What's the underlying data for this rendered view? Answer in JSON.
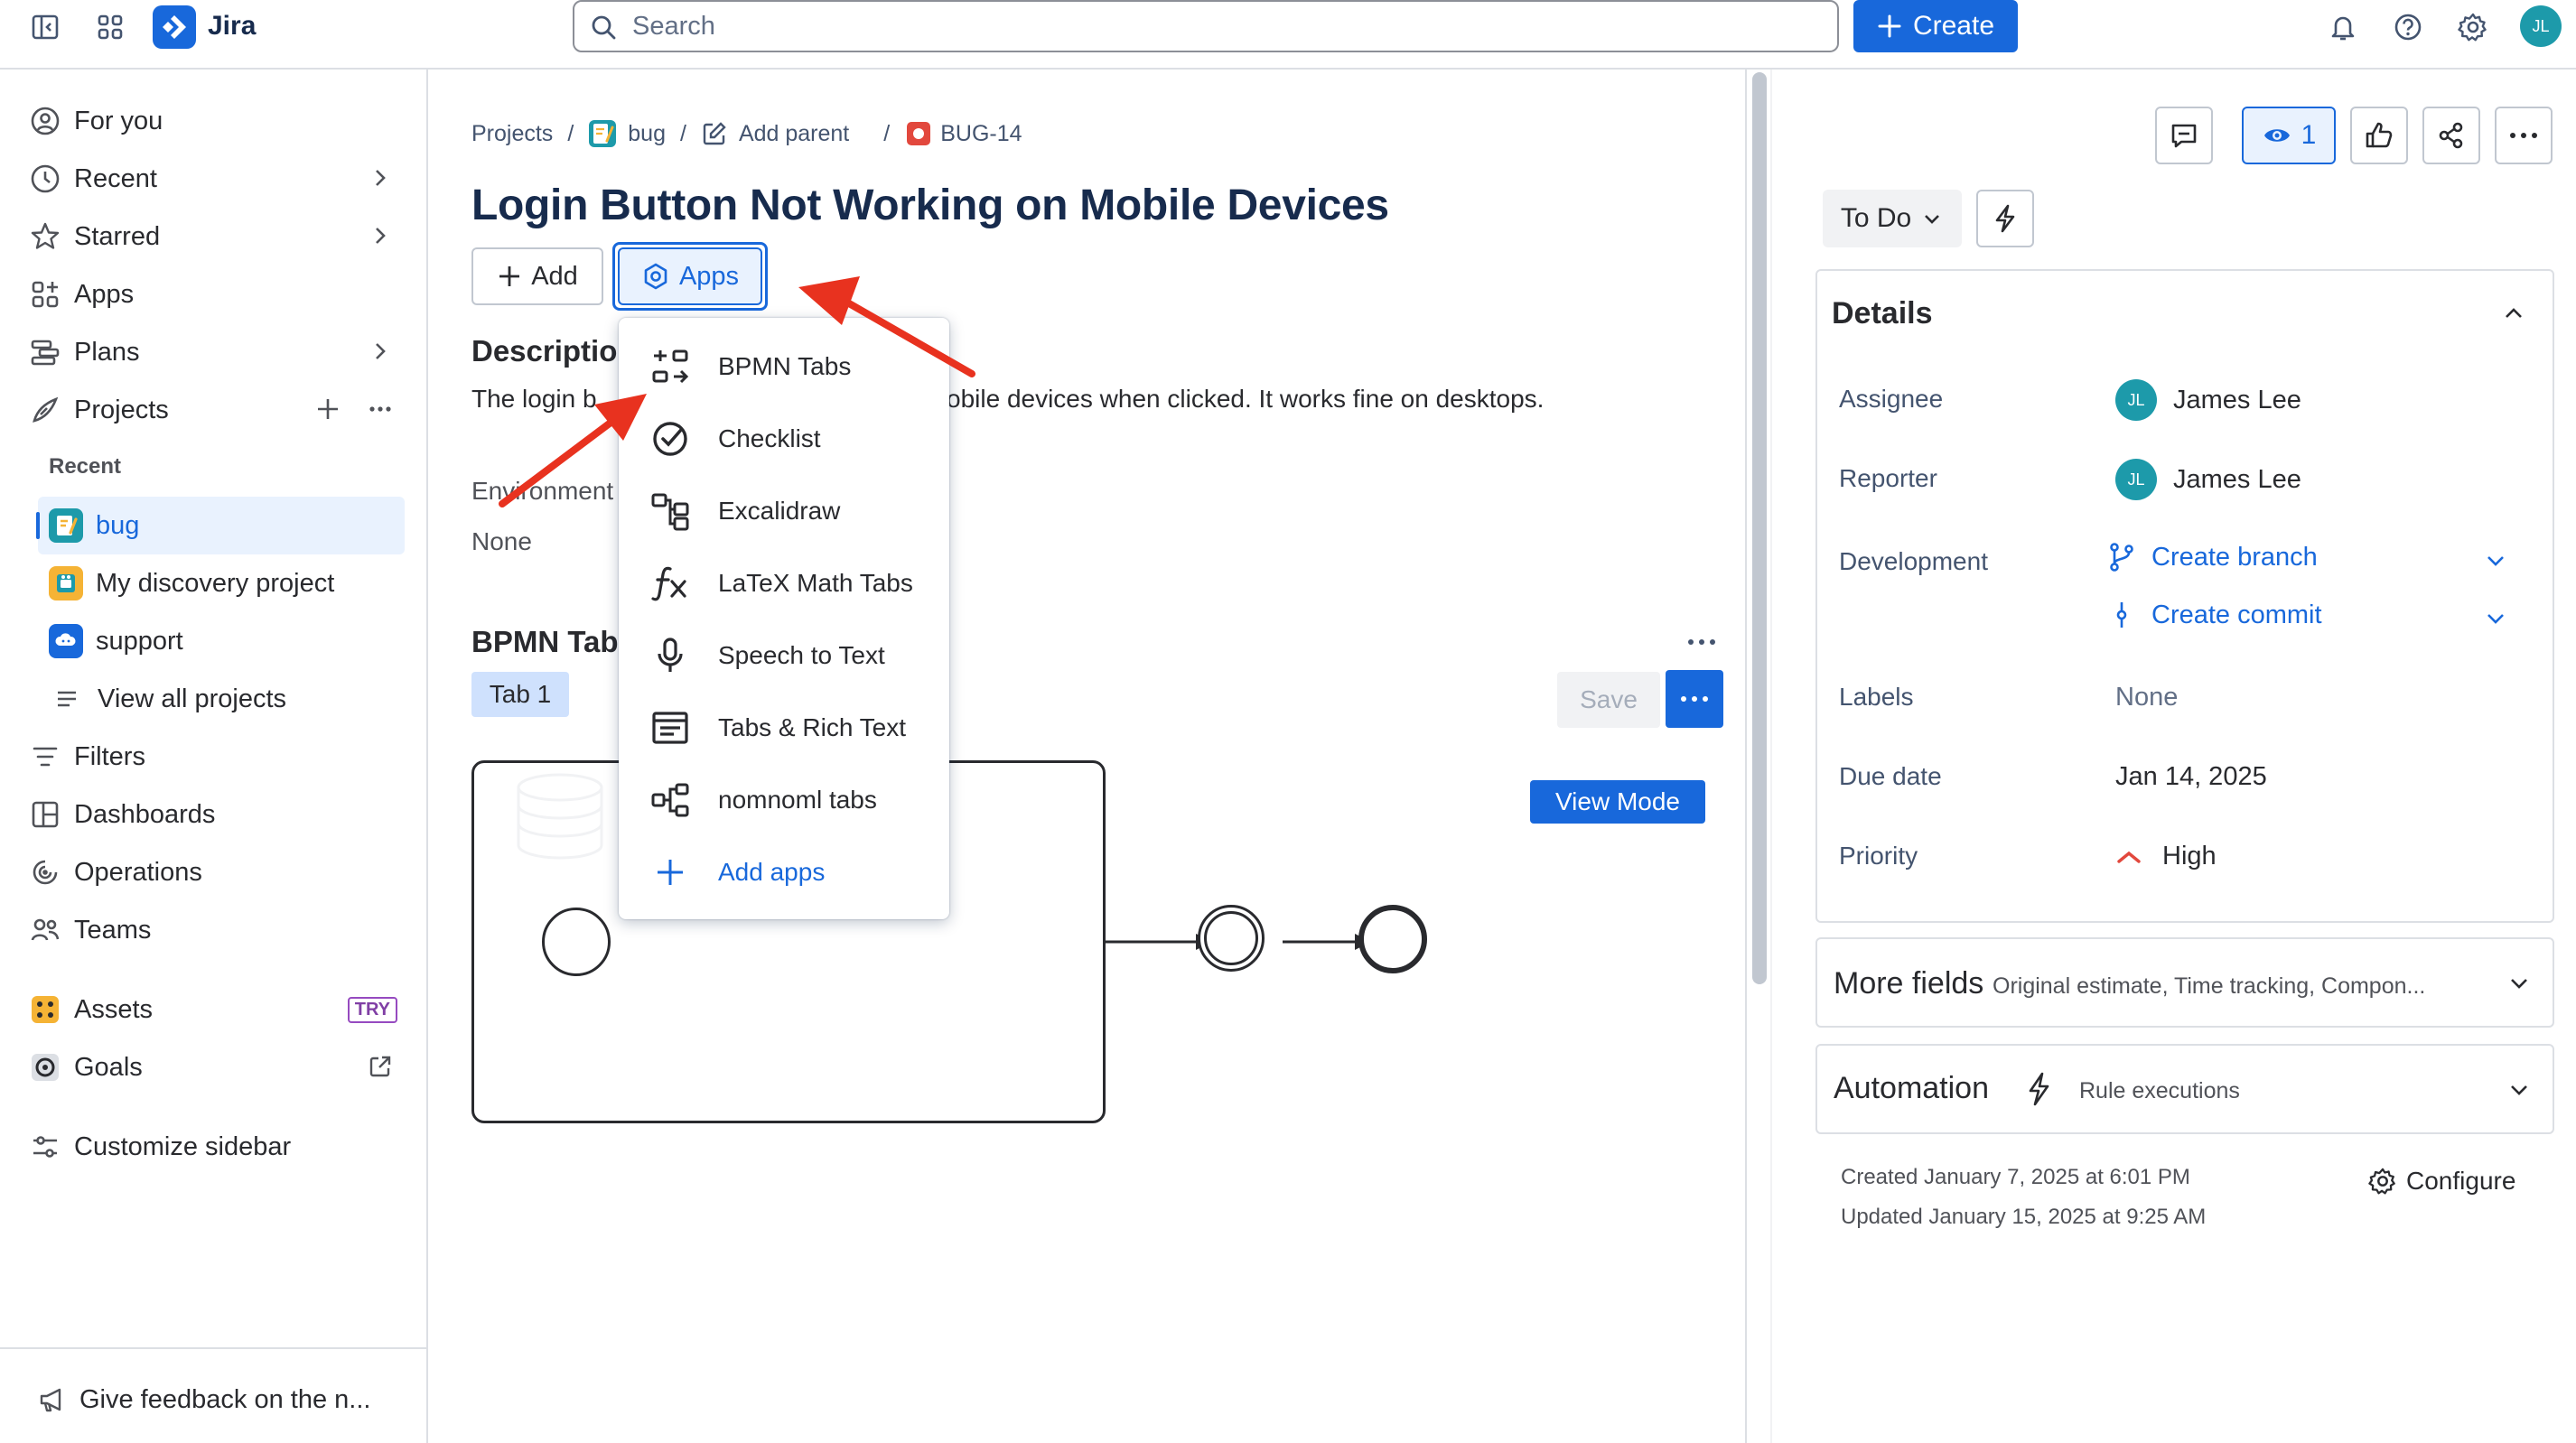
{
  "topbar": {
    "app_name": "Jira",
    "search_placeholder": "Search",
    "create_label": "Create",
    "user_initials": "JL"
  },
  "sidebar": {
    "items": [
      {
        "label": "For you"
      },
      {
        "label": "Recent"
      },
      {
        "label": "Starred"
      },
      {
        "label": "Apps"
      },
      {
        "label": "Plans"
      },
      {
        "label": "Projects"
      }
    ],
    "recent_label": "Recent",
    "projects": [
      {
        "label": "bug"
      },
      {
        "label": "My discovery project"
      },
      {
        "label": "support"
      },
      {
        "label": "View all projects"
      }
    ],
    "items2": [
      {
        "label": "Filters"
      },
      {
        "label": "Dashboards"
      },
      {
        "label": "Operations"
      },
      {
        "label": "Teams"
      },
      {
        "label": "Assets"
      },
      {
        "label": "Goals"
      },
      {
        "label": "Customize sidebar"
      }
    ],
    "try_badge": "TRY",
    "feedback": "Give feedback on the n..."
  },
  "issue": {
    "breadcrumb": {
      "projects": "Projects",
      "sep": "/",
      "project": "bug",
      "add_parent": "Add parent",
      "key": "BUG-14"
    },
    "title": "Login Button Not Working on Mobile Devices",
    "add_label": "Add",
    "apps_label": "Apps",
    "description_heading": "Descriptio",
    "description_start": "The login b",
    "description_end": "obile devices when clicked. It works fine on desktops.",
    "environment_heading": "Environment",
    "environment_value": "None",
    "bpmn_heading": "BPMN Tab",
    "tab_label": "Tab 1",
    "save_label": "Save",
    "view_mode_label": "View Mode"
  },
  "apps_menu": {
    "items": [
      {
        "label": "BPMN Tabs",
        "icon": "bpmn-icon"
      },
      {
        "label": "Checklist",
        "icon": "checklist-icon"
      },
      {
        "label": "Excalidraw",
        "icon": "excalidraw-icon"
      },
      {
        "label": "LaTeX Math Tabs",
        "icon": "fx-icon"
      },
      {
        "label": "Speech to Text",
        "icon": "microphone-icon"
      },
      {
        "label": "Tabs & Rich Text",
        "icon": "rich-text-icon"
      },
      {
        "label": "nomnoml tabs",
        "icon": "nomnoml-icon"
      },
      {
        "label": "Add apps",
        "icon": "plus-icon"
      }
    ]
  },
  "right_panel": {
    "watch_count": "1",
    "status": "To Do",
    "details_heading": "Details",
    "fields": {
      "assignee_label": "Assignee",
      "assignee_value": "James Lee",
      "reporter_label": "Reporter",
      "reporter_value": "James Lee",
      "development_label": "Development",
      "create_branch": "Create branch",
      "create_commit": "Create commit",
      "labels_label": "Labels",
      "labels_value": "None",
      "due_date_label": "Due date",
      "due_date_value": "Jan 14, 2025",
      "priority_label": "Priority",
      "priority_value": "High"
    },
    "more_fields_heading": "More fields",
    "more_fields_sub": "Original estimate, Time tracking, Compon...",
    "automation_heading": "Automation",
    "automation_sub": "Rule executions",
    "created": "Created January 7, 2025 at 6:01 PM",
    "updated": "Updated January 15, 2025 at 9:25 AM",
    "configure_label": "Configure",
    "avatar_initials": "JL"
  },
  "colors": {
    "brand": "#1868db",
    "annotation_arrow": "#e8321f",
    "avatar": "#1d9aaa"
  }
}
